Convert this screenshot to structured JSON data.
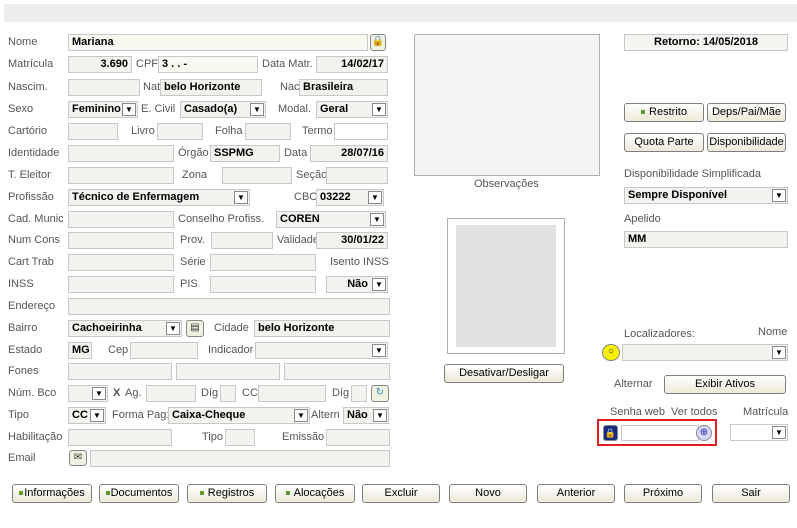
{
  "left": {
    "nome": {
      "label": "Nome",
      "value": "Mariana"
    },
    "matricula": {
      "label": "Matrícula",
      "value": "3.690"
    },
    "cpf": {
      "label": "CPF",
      "value": "3 .    .    -"
    },
    "data_matr": {
      "label": "Data Matr.",
      "value": "14/02/17"
    },
    "nascim": {
      "label": "Nascim.",
      "value": ""
    },
    "nat": {
      "label": "Nat",
      "value": "belo Horizonte"
    },
    "nac": {
      "label": "Nac",
      "value": "Brasileira"
    },
    "sexo": {
      "label": "Sexo",
      "value": "Feminino"
    },
    "estado_civil": {
      "label": "E. Civil",
      "value": "Casado(a)"
    },
    "modal": {
      "label": "Modal.",
      "value": "Geral"
    },
    "cartorio": {
      "label": "Cartório",
      "value": ""
    },
    "livro": {
      "label": "Livro",
      "value": ""
    },
    "folha": {
      "label": "Folha",
      "value": ""
    },
    "termo": {
      "label": "Termo",
      "value": ""
    },
    "identidade": {
      "label": "Identidade",
      "value": ""
    },
    "orgao": {
      "label": "Órgão",
      "value": "SSPMG"
    },
    "data_ident": {
      "label": "Data",
      "value": "28/07/16"
    },
    "t_eleitor": {
      "label": "T. Eleitor",
      "value": ""
    },
    "zona": {
      "label": "Zona",
      "value": ""
    },
    "secao": {
      "label": "Seção",
      "value": ""
    },
    "profissao": {
      "label": "Profissão",
      "value": "Técnico de Enfermagem"
    },
    "cbo": {
      "label": "CBO",
      "value": "03222"
    },
    "cad_munic": {
      "label": "Cad. Munic",
      "value": ""
    },
    "conselho": {
      "label": "Conselho Profiss.",
      "value": "COREN"
    },
    "num_cons": {
      "label": "Num Cons",
      "value": ""
    },
    "prov": {
      "label": "Prov.",
      "value": ""
    },
    "validade": {
      "label": "Validade",
      "value": "30/01/22"
    },
    "cart_trab": {
      "label": "Cart Trab",
      "value": ""
    },
    "serie": {
      "label": "Série",
      "value": ""
    },
    "isento_inss": {
      "label": "Isento INSS",
      "value": "Não"
    },
    "inss": {
      "label": "INSS",
      "value": ""
    },
    "pis": {
      "label": "PIS",
      "value": ""
    },
    "endereco": {
      "label": "Endereço",
      "value": ""
    },
    "bairro": {
      "label": "Bairro",
      "value": "Cachoeirinha"
    },
    "cidade": {
      "label": "Cidade",
      "value": "belo Horizonte"
    },
    "estado": {
      "label": "Estado",
      "value": "MG"
    },
    "cep": {
      "label": "Cep",
      "value": ""
    },
    "indicador": {
      "label": "Indicador",
      "value": ""
    },
    "fones": {
      "label": "Fones",
      "value": ""
    },
    "num_bco": {
      "label": "Núm. Bco",
      "value": ""
    },
    "x": {
      "label": "X"
    },
    "ag": {
      "label": "Ag.",
      "value": ""
    },
    "dig1": {
      "label": "Díg",
      "value": ""
    },
    "cc": {
      "label": "CC",
      "value": ""
    },
    "dig2": {
      "label": "Díg",
      "value": ""
    },
    "tipo": {
      "label": "Tipo",
      "value": "CC"
    },
    "forma_pag": {
      "label": "Forma Pag:",
      "value": "Caixa-Cheque"
    },
    "altern": {
      "label": "Altern",
      "value": "Não"
    },
    "habilitacao": {
      "label": "Habilitação",
      "value": ""
    },
    "tipo_hab": {
      "label": "Tipo",
      "value": ""
    },
    "emissao": {
      "label": "Emissão",
      "value": ""
    },
    "email": {
      "label": "Email",
      "value": ""
    }
  },
  "middle": {
    "observacoes_label": "Observações",
    "desativar_label": "Desativar/Desligar"
  },
  "right": {
    "retorno": "Retorno: 14/05/2018",
    "restrito_label": "Restrito",
    "deps_label": "Deps/Pai/Mãe",
    "quota_label": "Quota Parte",
    "disponibilidade_label": "Disponibilidade",
    "disp_simpl_label": "Disponibilidade Simplificada",
    "disp_simpl_value": "Sempre Disponível",
    "apelido_label": "Apelido",
    "apelido_value": "MM",
    "localizadores_label": "Localizadores:",
    "nome_label": "Nome",
    "alternar_label": "Alternar",
    "exibir_ativos_label": "Exibir Ativos",
    "senha_web_label": "Senha web",
    "ver_todos_label": "Ver todos",
    "matricula_label": "Matrícula"
  },
  "bottom": {
    "informacoes": "Informações",
    "documentos": "Documentos",
    "registros": "Registros",
    "alocacoes": "Alocações",
    "excluir": "Excluir",
    "novo": "Novo",
    "anterior": "Anterior",
    "proximo": "Próximo",
    "sair": "Sair"
  },
  "colors": {
    "highlight_border": "#e02020",
    "bullet": "#5c9c2c"
  },
  "icons": [
    "lock-icon",
    "expand-icon",
    "lightbulb-icon",
    "padlock-icon",
    "crosshair-icon",
    "mail-icon",
    "list-icon",
    "refresh-icon"
  ]
}
